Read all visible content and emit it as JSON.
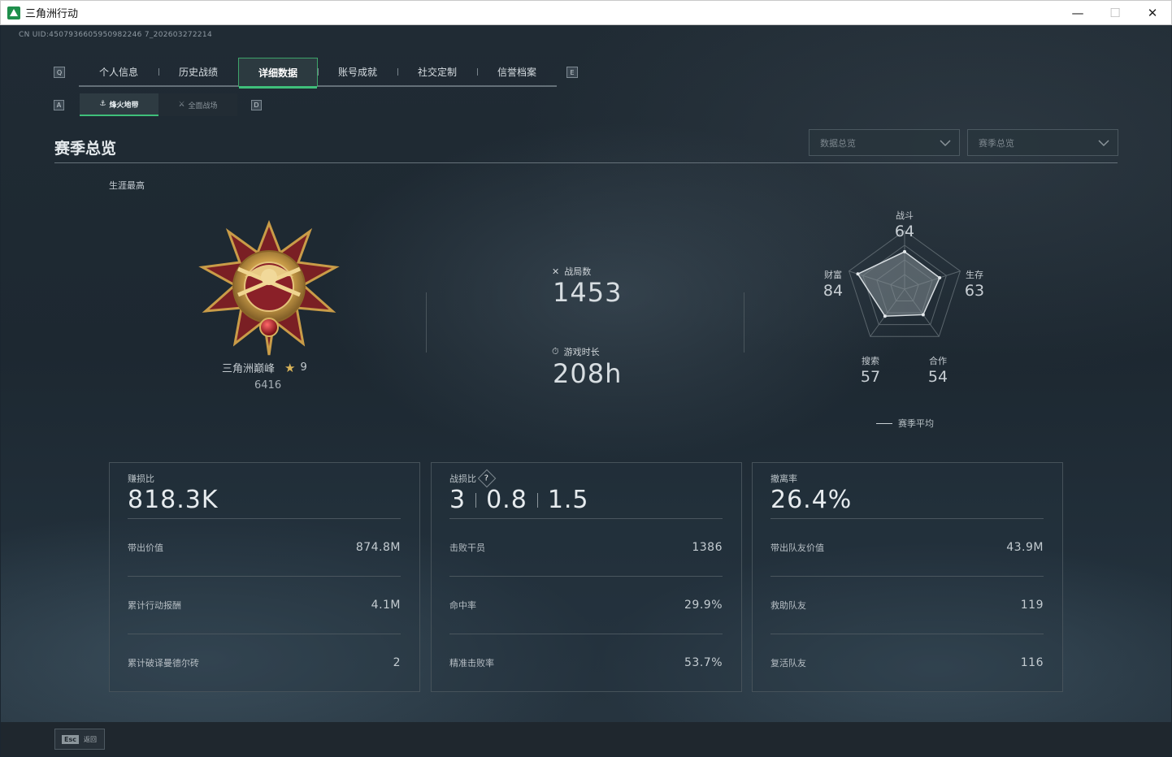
{
  "window": {
    "title": "三角洲行动",
    "minimize": "—",
    "maximize": "☐",
    "close": "✕"
  },
  "uid": "CN UID:4507936605950982246 7_202603272214",
  "tab_keys": {
    "left": "Q",
    "right": "E"
  },
  "tabs": [
    "个人信息",
    "历史战绩",
    "详细数据",
    "账号成就",
    "社交定制",
    "信誉档案"
  ],
  "active_tab": "详细数据",
  "subtab_keys": {
    "left": "A",
    "right": "D"
  },
  "subtabs": [
    {
      "label": "烽火地带",
      "icon": "zone-icon"
    },
    {
      "label": "全面战场",
      "icon": "battlefield-icon"
    }
  ],
  "section": {
    "title": "赛季总览"
  },
  "dropdowns": {
    "data": "数据总览",
    "season": "赛季总览"
  },
  "career": {
    "label": "生涯最高",
    "rank_name": "三角洲巅峰",
    "star_level": "9",
    "score": "6416"
  },
  "matches": {
    "label": "战局数",
    "value": "1453"
  },
  "playtime": {
    "label": "游戏时长",
    "value": "208h"
  },
  "radar": {
    "axes": [
      {
        "label": "战斗",
        "value": "64"
      },
      {
        "label": "生存",
        "value": "63"
      },
      {
        "label": "合作",
        "value": "54"
      },
      {
        "label": "搜索",
        "value": "57"
      },
      {
        "label": "财富",
        "value": "84"
      }
    ],
    "legend": "赛季平均"
  },
  "cards": [
    {
      "key": "赚损比",
      "value": "818.3K",
      "rows": [
        {
          "label": "带出价值",
          "value": "874.8M"
        },
        {
          "label": "累计行动报酬",
          "value": "4.1M"
        },
        {
          "label": "累计破译曼德尔砖",
          "value": "2"
        }
      ]
    },
    {
      "key": "战损比",
      "values": [
        "3",
        "0.8",
        "1.5"
      ],
      "help": "?",
      "rows": [
        {
          "label": "击败干员",
          "value": "1386"
        },
        {
          "label": "命中率",
          "value": "29.9%"
        },
        {
          "label": "精准击败率",
          "value": "53.7%"
        }
      ]
    },
    {
      "key": "撤离率",
      "value": "26.4%",
      "rows": [
        {
          "label": "带出队友价值",
          "value": "43.9M"
        },
        {
          "label": "救助队友",
          "value": "119"
        },
        {
          "label": "复活队友",
          "value": "116"
        }
      ]
    }
  ],
  "bottom": {
    "esc_key": "Esc",
    "esc_label": "返回"
  }
}
